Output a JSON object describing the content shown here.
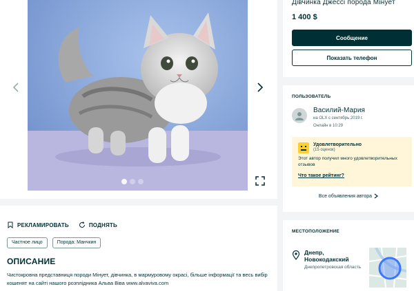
{
  "gallery": {
    "prev_icon": "chevron-left-icon",
    "next_icon": "chevron-right-icon",
    "fullscreen_icon": "expand-icon"
  },
  "actions": {
    "report_label": "РЕКЛАМИРОВАТЬ",
    "refresh_label": "ПОДНЯТЬ"
  },
  "tags": [
    "Частное лицо",
    "Порода: Манчкин"
  ],
  "description": {
    "title": "ОПИСАНИЕ",
    "text": "Чистокровна представниця породи Мінует, дівчинка, в мармуровому окрасі, більше інформації та весь вибір кошенят на сайті нашого розплідника Альва Віва www.alvaviva.com"
  },
  "listing": {
    "title": "Дівчинка Джессі порода Мінует",
    "price": "1 400 $",
    "message_button": "Сообщение",
    "phone_button": "Показать телефон"
  },
  "user": {
    "section_label": "ПОЛЬЗОВАТЕЛЬ",
    "name": "Василий-Мария",
    "since": "на OLX с сентябрь 2019 г.",
    "online": "Онлайн в 10:29",
    "rating_title": "Удовлетворительно",
    "rating_count": "(15 оценок)",
    "rating_text": "Этот автор получил много удовлетворительных отзывов",
    "rating_link": "Что такое рейтинг?",
    "all_ads": "Все объявления автора"
  },
  "location": {
    "section_label": "МЕСТОПОЛОЖЕНИЕ",
    "city": "Днепр, Новокодакский",
    "region": "Днепропетровская область"
  },
  "colors": {
    "primary": "#002f34",
    "rating_bg": "#fff6d9",
    "smiley": "#ffce32"
  }
}
